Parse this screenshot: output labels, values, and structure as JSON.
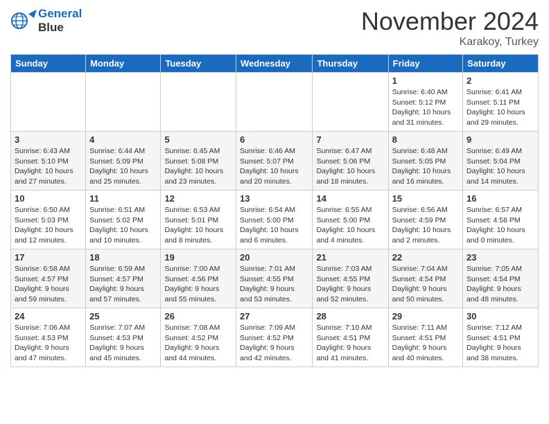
{
  "header": {
    "logo_line1": "General",
    "logo_line2": "Blue",
    "month": "November 2024",
    "location": "Karakoy, Turkey"
  },
  "weekdays": [
    "Sunday",
    "Monday",
    "Tuesday",
    "Wednesday",
    "Thursday",
    "Friday",
    "Saturday"
  ],
  "weeks": [
    [
      {
        "day": "",
        "info": ""
      },
      {
        "day": "",
        "info": ""
      },
      {
        "day": "",
        "info": ""
      },
      {
        "day": "",
        "info": ""
      },
      {
        "day": "",
        "info": ""
      },
      {
        "day": "1",
        "info": "Sunrise: 6:40 AM\nSunset: 5:12 PM\nDaylight: 10 hours\nand 31 minutes."
      },
      {
        "day": "2",
        "info": "Sunrise: 6:41 AM\nSunset: 5:11 PM\nDaylight: 10 hours\nand 29 minutes."
      }
    ],
    [
      {
        "day": "3",
        "info": "Sunrise: 6:43 AM\nSunset: 5:10 PM\nDaylight: 10 hours\nand 27 minutes."
      },
      {
        "day": "4",
        "info": "Sunrise: 6:44 AM\nSunset: 5:09 PM\nDaylight: 10 hours\nand 25 minutes."
      },
      {
        "day": "5",
        "info": "Sunrise: 6:45 AM\nSunset: 5:08 PM\nDaylight: 10 hours\nand 23 minutes."
      },
      {
        "day": "6",
        "info": "Sunrise: 6:46 AM\nSunset: 5:07 PM\nDaylight: 10 hours\nand 20 minutes."
      },
      {
        "day": "7",
        "info": "Sunrise: 6:47 AM\nSunset: 5:06 PM\nDaylight: 10 hours\nand 18 minutes."
      },
      {
        "day": "8",
        "info": "Sunrise: 6:48 AM\nSunset: 5:05 PM\nDaylight: 10 hours\nand 16 minutes."
      },
      {
        "day": "9",
        "info": "Sunrise: 6:49 AM\nSunset: 5:04 PM\nDaylight: 10 hours\nand 14 minutes."
      }
    ],
    [
      {
        "day": "10",
        "info": "Sunrise: 6:50 AM\nSunset: 5:03 PM\nDaylight: 10 hours\nand 12 minutes."
      },
      {
        "day": "11",
        "info": "Sunrise: 6:51 AM\nSunset: 5:02 PM\nDaylight: 10 hours\nand 10 minutes."
      },
      {
        "day": "12",
        "info": "Sunrise: 6:53 AM\nSunset: 5:01 PM\nDaylight: 10 hours\nand 8 minutes."
      },
      {
        "day": "13",
        "info": "Sunrise: 6:54 AM\nSunset: 5:00 PM\nDaylight: 10 hours\nand 6 minutes."
      },
      {
        "day": "14",
        "info": "Sunrise: 6:55 AM\nSunset: 5:00 PM\nDaylight: 10 hours\nand 4 minutes."
      },
      {
        "day": "15",
        "info": "Sunrise: 6:56 AM\nSunset: 4:59 PM\nDaylight: 10 hours\nand 2 minutes."
      },
      {
        "day": "16",
        "info": "Sunrise: 6:57 AM\nSunset: 4:58 PM\nDaylight: 10 hours\nand 0 minutes."
      }
    ],
    [
      {
        "day": "17",
        "info": "Sunrise: 6:58 AM\nSunset: 4:57 PM\nDaylight: 9 hours\nand 59 minutes."
      },
      {
        "day": "18",
        "info": "Sunrise: 6:59 AM\nSunset: 4:57 PM\nDaylight: 9 hours\nand 57 minutes."
      },
      {
        "day": "19",
        "info": "Sunrise: 7:00 AM\nSunset: 4:56 PM\nDaylight: 9 hours\nand 55 minutes."
      },
      {
        "day": "20",
        "info": "Sunrise: 7:01 AM\nSunset: 4:55 PM\nDaylight: 9 hours\nand 53 minutes."
      },
      {
        "day": "21",
        "info": "Sunrise: 7:03 AM\nSunset: 4:55 PM\nDaylight: 9 hours\nand 52 minutes."
      },
      {
        "day": "22",
        "info": "Sunrise: 7:04 AM\nSunset: 4:54 PM\nDaylight: 9 hours\nand 50 minutes."
      },
      {
        "day": "23",
        "info": "Sunrise: 7:05 AM\nSunset: 4:54 PM\nDaylight: 9 hours\nand 48 minutes."
      }
    ],
    [
      {
        "day": "24",
        "info": "Sunrise: 7:06 AM\nSunset: 4:53 PM\nDaylight: 9 hours\nand 47 minutes."
      },
      {
        "day": "25",
        "info": "Sunrise: 7:07 AM\nSunset: 4:53 PM\nDaylight: 9 hours\nand 45 minutes."
      },
      {
        "day": "26",
        "info": "Sunrise: 7:08 AM\nSunset: 4:52 PM\nDaylight: 9 hours\nand 44 minutes."
      },
      {
        "day": "27",
        "info": "Sunrise: 7:09 AM\nSunset: 4:52 PM\nDaylight: 9 hours\nand 42 minutes."
      },
      {
        "day": "28",
        "info": "Sunrise: 7:10 AM\nSunset: 4:51 PM\nDaylight: 9 hours\nand 41 minutes."
      },
      {
        "day": "29",
        "info": "Sunrise: 7:11 AM\nSunset: 4:51 PM\nDaylight: 9 hours\nand 40 minutes."
      },
      {
        "day": "30",
        "info": "Sunrise: 7:12 AM\nSunset: 4:51 PM\nDaylight: 9 hours\nand 38 minutes."
      }
    ]
  ]
}
